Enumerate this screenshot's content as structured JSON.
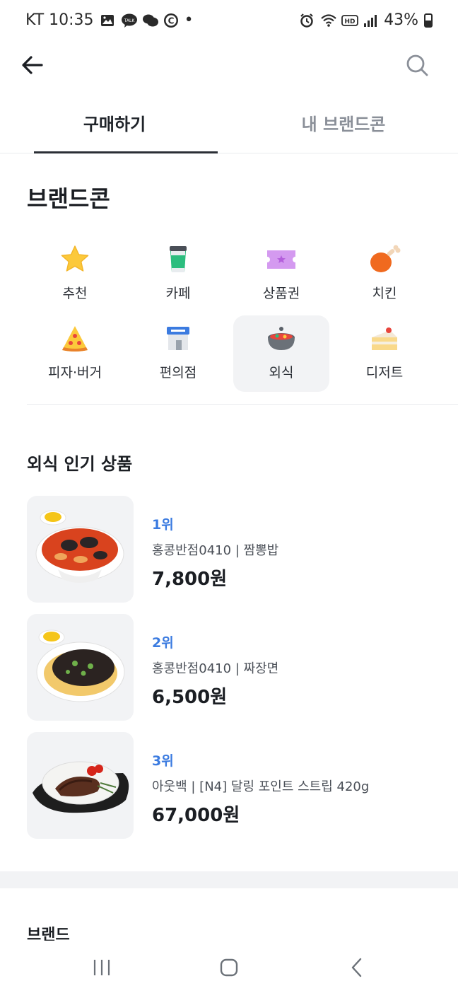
{
  "status_bar": {
    "carrier_time": "KT 10:35",
    "dot": "•",
    "battery_text": "43%"
  },
  "tabs": [
    {
      "label": "구매하기",
      "active": true
    },
    {
      "label": "내 브랜드콘",
      "active": false
    }
  ],
  "section_title": "브랜드콘",
  "categories": [
    {
      "label": "추천",
      "icon": "star-icon"
    },
    {
      "label": "카페",
      "icon": "coffee-cup-icon"
    },
    {
      "label": "상품권",
      "icon": "ticket-icon"
    },
    {
      "label": "치킨",
      "icon": "chicken-leg-icon"
    },
    {
      "label": "피자·버거",
      "icon": "pizza-icon"
    },
    {
      "label": "편의점",
      "icon": "store-icon"
    },
    {
      "label": "외식",
      "icon": "pot-icon",
      "selected": true
    },
    {
      "label": "디저트",
      "icon": "cake-icon"
    }
  ],
  "popular": {
    "title": "외식 인기 상품",
    "items": [
      {
        "rank": "1위",
        "name": "홍콩반점0410 | 짬뽕밥",
        "price": "7,800원"
      },
      {
        "rank": "2위",
        "name": "홍콩반점0410 | 짜장면",
        "price": "6,500원"
      },
      {
        "rank": "3위",
        "name": "아웃백 | [N4] 달링 포인트 스트립 420g",
        "price": "67,000원"
      }
    ]
  },
  "brand_section_title": "브랜드",
  "colors": {
    "accent_rank": "#3b7be0",
    "tab_underline": "#2b2f36",
    "card_bg": "#f2f3f5"
  }
}
